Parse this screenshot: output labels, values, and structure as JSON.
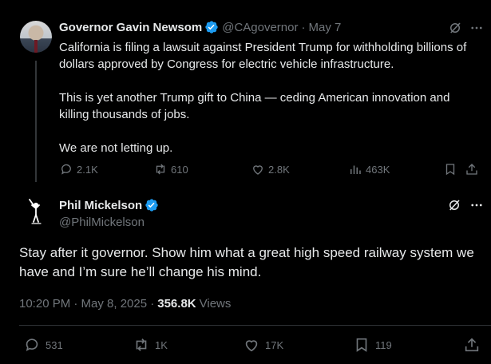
{
  "parent_tweet": {
    "author_name": "Governor Gavin Newsom",
    "handle": "@CAgovernor",
    "separator": "·",
    "date": "May 7",
    "paragraphs": [
      "California is filing a lawsuit against President Trump for withholding billions of dollars approved by Congress for electric vehicle infrastructure.",
      "This is yet another Trump gift to China — ceding American innovation and killing thousands of jobs.",
      "We are not letting up."
    ],
    "stats": {
      "replies": "2.1K",
      "reposts": "610",
      "likes": "2.8K",
      "views": "463K"
    }
  },
  "main_tweet": {
    "author_name": "Phil Mickelson",
    "handle": "@PhilMickelson",
    "text": "Stay after it governor. Show him what a great high speed railway system we have and I’m sure he’ll change his mind.",
    "timestamp": "10:20 PM · May 8, 2025 ·",
    "views_count": "356.8K",
    "views_label": "Views",
    "stats": {
      "replies": "531",
      "reposts": "1K",
      "likes": "17K",
      "bookmarks": "119"
    }
  },
  "colors": {
    "background": "#000000",
    "text": "#e7e9ea",
    "secondary_text": "#71767b",
    "verified_badge": "#1d9bf0",
    "divider": "#2f3336"
  },
  "icons": [
    "reply-icon",
    "repost-icon",
    "like-icon",
    "views-icon",
    "bookmark-icon",
    "share-icon",
    "grok-icon",
    "more-icon",
    "verified-badge-icon"
  ]
}
